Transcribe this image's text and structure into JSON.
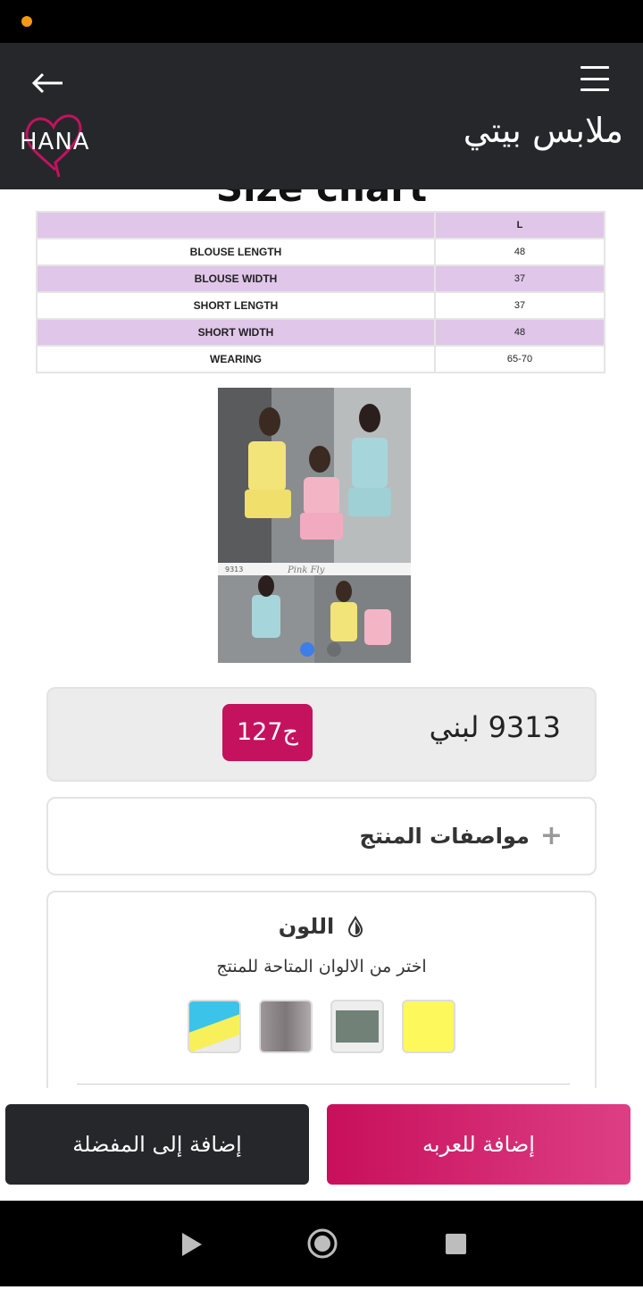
{
  "header": {
    "title": "ملابس بيتي",
    "logo_text": "HANA",
    "menu_icon": "hamburger-menu-icon",
    "back_icon": "arrow-left-icon"
  },
  "size_chart": {
    "title": "Size chart",
    "size_column": "L",
    "rows": [
      {
        "label": "BLOUSE LENGTH",
        "value": "48"
      },
      {
        "label": "BLOUSE WIDTH",
        "value": "37"
      },
      {
        "label": "SHORT LENGTH",
        "value": "37"
      },
      {
        "label": "SHORT WIDTH",
        "value": "48"
      },
      {
        "label": "WEARING",
        "value": "65-70"
      }
    ]
  },
  "product_image": {
    "code": "9313",
    "brand": "Pink Fly",
    "carousel_count": 2,
    "active_index": 0
  },
  "product": {
    "name": "9313 لبني",
    "price": "127ج"
  },
  "specs": {
    "label": "مواصفات المنتج"
  },
  "color_section": {
    "heading": "اللون",
    "subtitle": "اختر من الالوان المتاحة للمنتج",
    "swatches": [
      "yellow",
      "grey-green",
      "mauve-grey",
      "multicolor"
    ]
  },
  "actions": {
    "add_to_favorites": "إضافة إلى المفضلة",
    "add_to_cart": "إضافة للعربه"
  },
  "colors": {
    "accent": "#c4125e",
    "header_bg": "#26272b",
    "table_pink": "#e0c6e9"
  }
}
